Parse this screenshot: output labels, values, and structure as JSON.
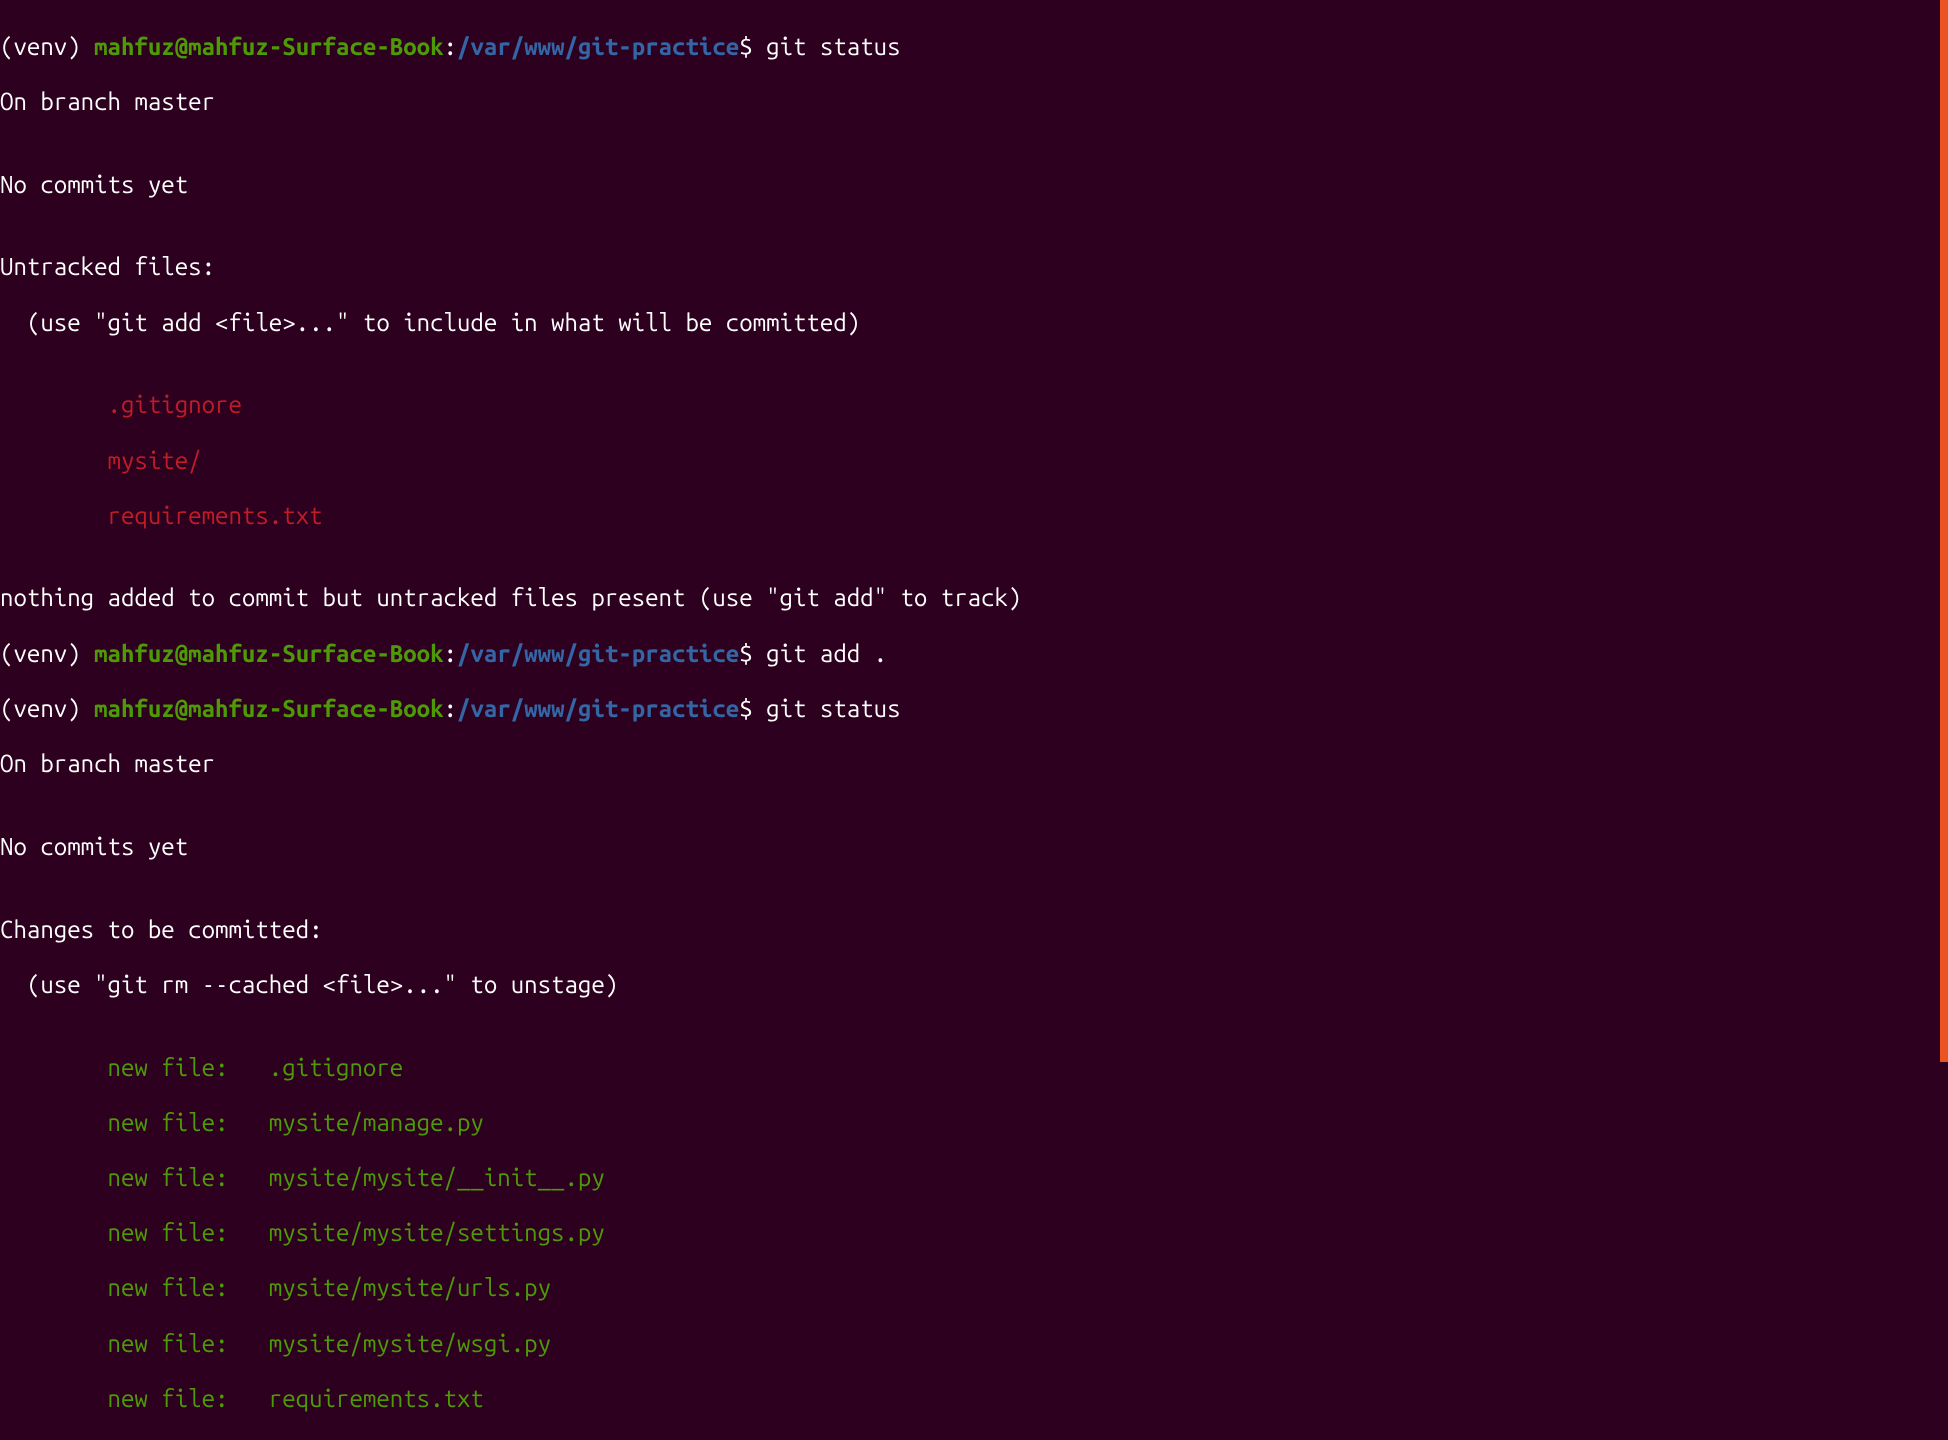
{
  "colors": {
    "bg": "#2c001e",
    "white": "#ffffff",
    "green": "#4e9a06",
    "blue": "#3465a4",
    "red": "#c01c28",
    "scrollbar": "#e95420"
  },
  "prompt": {
    "venv": "(venv) ",
    "user_host": "mahfuz@mahfuz-Surface-Book",
    "colon": ":",
    "path": "/var/www/git-practice",
    "dollar": "$ "
  },
  "commands": {
    "c1": "git status",
    "c2": "git add .",
    "c3": "git status"
  },
  "output1": {
    "l1": "On branch master",
    "l2": "",
    "l3": "No commits yet",
    "l4": "",
    "l5": "Untracked files:",
    "l6": "  (use \"git add <file>...\" to include in what will be committed)",
    "l7": "",
    "f1": "        .gitignore",
    "f2": "        mysite/",
    "f3": "        requirements.txt",
    "l8": "",
    "l9": "nothing added to commit but untracked files present (use \"git add\" to track)"
  },
  "output2": {
    "l1": "On branch master",
    "l2": "",
    "l3": "No commits yet",
    "l4": "",
    "l5": "Changes to be committed:",
    "l6": "  (use \"git rm --cached <file>...\" to unstage)",
    "l7": "",
    "f1": "        new file:   .gitignore",
    "f2": "        new file:   mysite/manage.py",
    "f3": "        new file:   mysite/mysite/__init__.py",
    "f4": "        new file:   mysite/mysite/settings.py",
    "f5": "        new file:   mysite/mysite/urls.py",
    "f6": "        new file:   mysite/mysite/wsgi.py",
    "f7": "        new file:   requirements.txt"
  }
}
